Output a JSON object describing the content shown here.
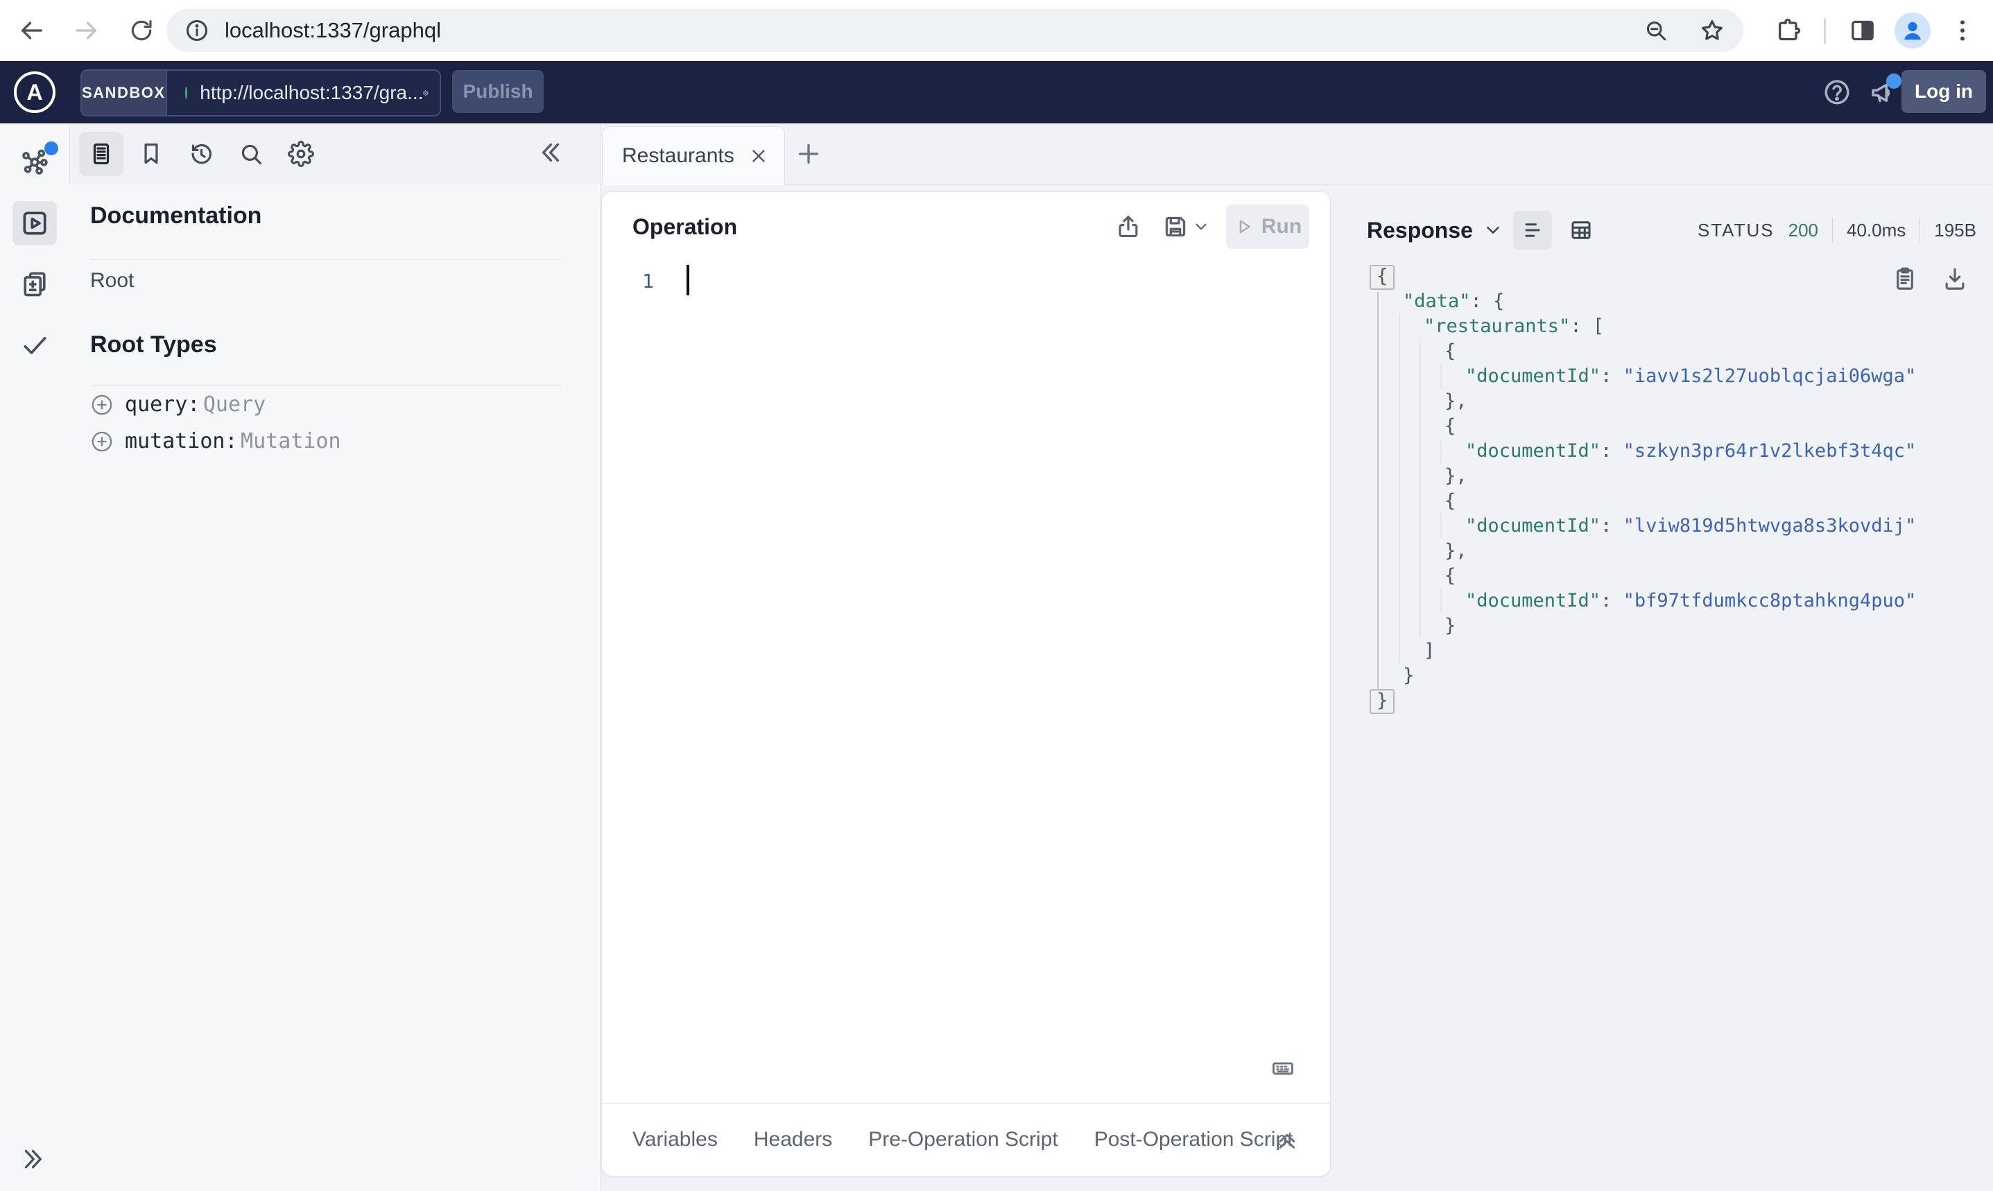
{
  "browser": {
    "url": "localhost:1337/graphql"
  },
  "sandbox_header": {
    "badge": "SANDBOX",
    "endpoint": "http://localhost:1337/gra...",
    "publish_label": "Publish",
    "login_label": "Log in"
  },
  "doc_panel": {
    "title": "Documentation",
    "root_item": "Root",
    "root_types_title": "Root Types",
    "fields": [
      {
        "name": "query:",
        "type": "Query"
      },
      {
        "name": "mutation:",
        "type": "Mutation"
      }
    ]
  },
  "tabs": {
    "active": "Restaurants"
  },
  "operation": {
    "title": "Operation",
    "run_label": "Run",
    "line_number": "1",
    "bottom_tabs": [
      "Variables",
      "Headers",
      "Pre-Operation Script",
      "Post-Operation Script"
    ]
  },
  "response": {
    "title": "Response",
    "status_label": "STATUS",
    "status_code": "200",
    "time": "40.0ms",
    "size": "195B",
    "lines": [
      {
        "i": 0,
        "box": true,
        "t": [
          [
            "p",
            "{"
          ]
        ]
      },
      {
        "i": 1,
        "t": [
          [
            "k",
            "\"data\""
          ],
          [
            "p",
            ": {"
          ]
        ]
      },
      {
        "i": 2,
        "t": [
          [
            "k",
            "\"restaurants\""
          ],
          [
            "p",
            ": ["
          ]
        ]
      },
      {
        "i": 3,
        "t": [
          [
            "p",
            "{"
          ]
        ]
      },
      {
        "i": 4,
        "t": [
          [
            "k",
            "\"documentId\""
          ],
          [
            "p",
            ": "
          ],
          [
            "s",
            "\"iavv1s2l27uoblqcjai06wga\""
          ]
        ]
      },
      {
        "i": 3,
        "t": [
          [
            "p",
            "},"
          ]
        ]
      },
      {
        "i": 3,
        "t": [
          [
            "p",
            "{"
          ]
        ]
      },
      {
        "i": 4,
        "t": [
          [
            "k",
            "\"documentId\""
          ],
          [
            "p",
            ": "
          ],
          [
            "s",
            "\"szkyn3pr64r1v2lkebf3t4qc\""
          ]
        ]
      },
      {
        "i": 3,
        "t": [
          [
            "p",
            "},"
          ]
        ]
      },
      {
        "i": 3,
        "t": [
          [
            "p",
            "{"
          ]
        ]
      },
      {
        "i": 4,
        "t": [
          [
            "k",
            "\"documentId\""
          ],
          [
            "p",
            ": "
          ],
          [
            "s",
            "\"lviw819d5htwvga8s3kovdij\""
          ]
        ]
      },
      {
        "i": 3,
        "t": [
          [
            "p",
            "},"
          ]
        ]
      },
      {
        "i": 3,
        "t": [
          [
            "p",
            "{"
          ]
        ]
      },
      {
        "i": 4,
        "t": [
          [
            "k",
            "\"documentId\""
          ],
          [
            "p",
            ": "
          ],
          [
            "s",
            "\"bf97tfdumkcc8ptahkng4puo\""
          ]
        ]
      },
      {
        "i": 3,
        "t": [
          [
            "p",
            "}"
          ]
        ]
      },
      {
        "i": 2,
        "t": [
          [
            "p",
            "]"
          ]
        ]
      },
      {
        "i": 1,
        "t": [
          [
            "p",
            "}"
          ]
        ]
      },
      {
        "i": 0,
        "box": true,
        "t": [
          [
            "p",
            "}"
          ]
        ]
      }
    ]
  },
  "icons": {
    "rail": [
      "graph-icon",
      "explorer-icon",
      "changes-diff-icon",
      "checks-icon",
      "expand-sidebar-icon"
    ],
    "doc_toolbar": [
      "documentation-icon",
      "bookmark-icon",
      "history-icon",
      "search-icon",
      "settings-icon"
    ],
    "response_tools": [
      "copy-icon",
      "download-icon"
    ]
  },
  "colors": {
    "header_bg": "#1c2342",
    "endpoint_ok_dot": "#3fa96c",
    "status_green": "#2e7d5b",
    "json_key": "#2c7a6f",
    "json_string": "#3a64b4",
    "notification_blue": "#4596ec",
    "app_bg": "#f1f2f5"
  }
}
